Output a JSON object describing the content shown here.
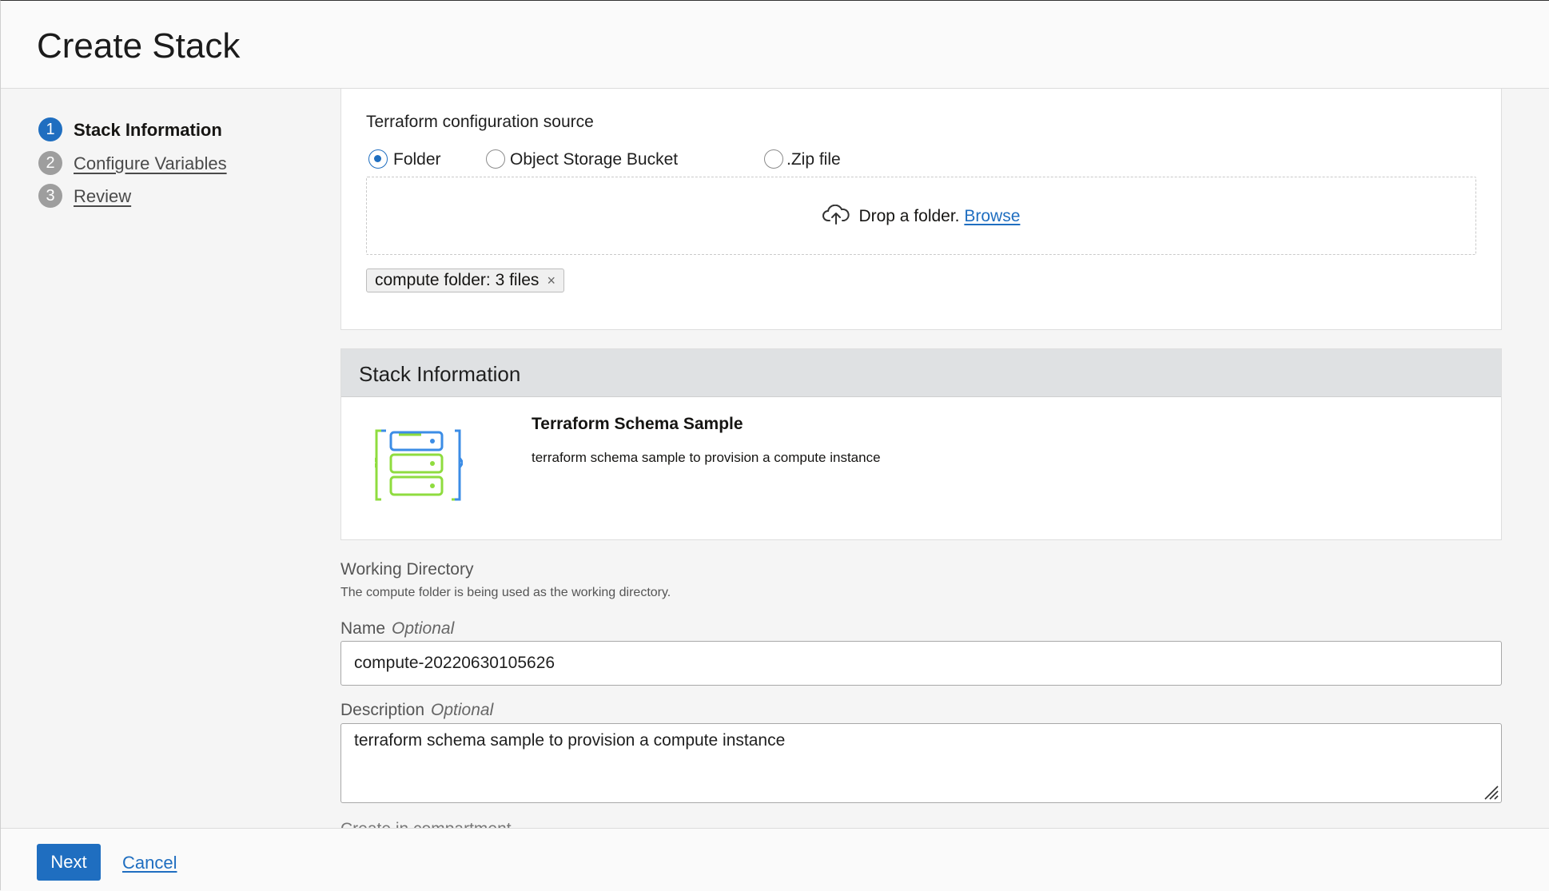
{
  "header": {
    "title": "Create Stack"
  },
  "steps": [
    {
      "number": "1",
      "label": "Stack Information"
    },
    {
      "number": "2",
      "label": "Configure Variables"
    },
    {
      "number": "3",
      "label": "Review"
    }
  ],
  "config_source": {
    "title": "Terraform configuration source",
    "options": [
      {
        "label": "Folder",
        "selected": true
      },
      {
        "label": "Object Storage Bucket",
        "selected": false
      },
      {
        "label": ".Zip file",
        "selected": false
      }
    ],
    "drop_text": "Drop a folder.",
    "browse_label": "Browse",
    "chip_label": "compute folder: 3 files",
    "chip_close": "×"
  },
  "stack_info": {
    "section_title": "Stack Information",
    "icon": "server-stack-icon",
    "name": "Terraform Schema Sample",
    "description": "terraform schema sample to provision a compute instance"
  },
  "working_directory": {
    "label": "Working Directory",
    "helper": "The compute folder is being used as the working directory."
  },
  "name_field": {
    "label": "Name",
    "optional": "Optional",
    "value": "compute-20220630105626"
  },
  "description_field": {
    "label": "Description",
    "optional": "Optional",
    "value": "terraform schema sample to provision a compute instance"
  },
  "next_field_label": "Create in compartment",
  "footer": {
    "next_label": "Next",
    "cancel_label": "Cancel"
  },
  "colors": {
    "primary": "#1f6ec0",
    "icon_green": "#8fdc3f",
    "icon_blue": "#3c8de6"
  }
}
